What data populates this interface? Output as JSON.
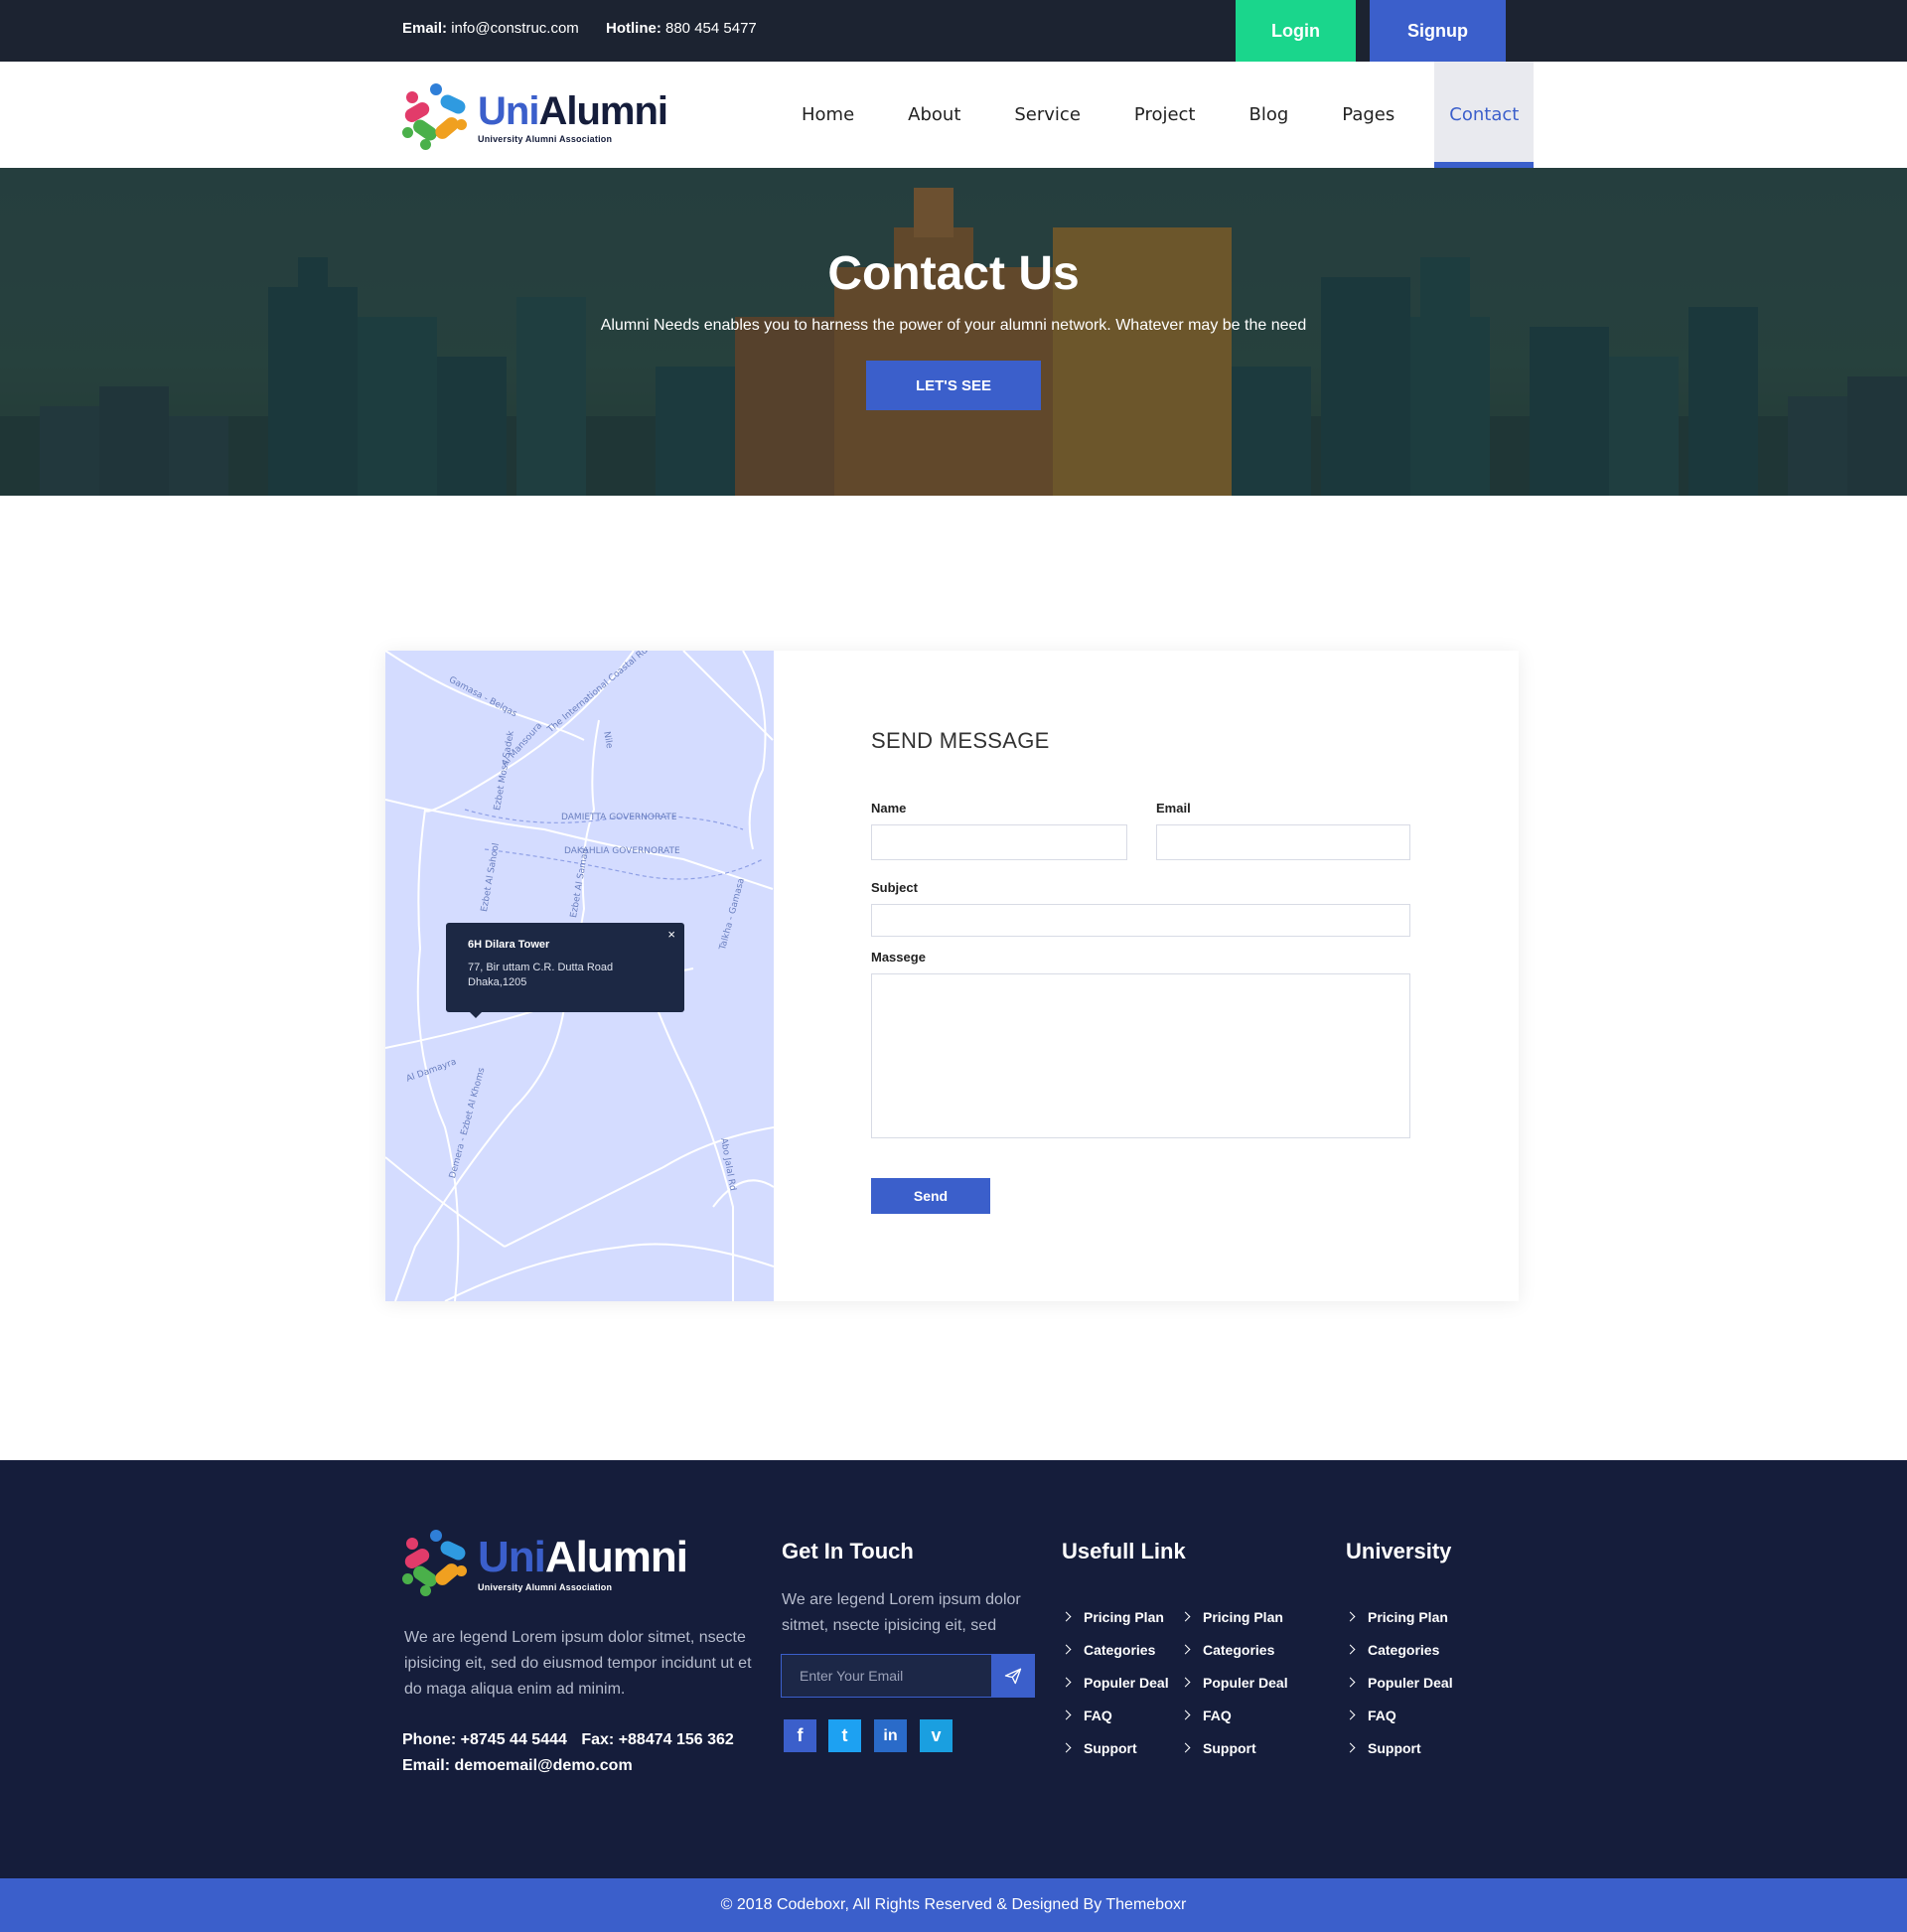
{
  "topbar": {
    "email_label": "Email:",
    "email_value": "info@construc.com",
    "hotline_label": "Hotline:",
    "hotline_value": "880 454 5477",
    "login_label": "Login",
    "signup_label": "Signup"
  },
  "logo": {
    "brand_uni": "Uni",
    "brand_alumni": "Alumni",
    "tagline": "University Alumni Association"
  },
  "nav": {
    "items": [
      {
        "label": "Home"
      },
      {
        "label": "About"
      },
      {
        "label": "Service"
      },
      {
        "label": "Project"
      },
      {
        "label": "Blog"
      },
      {
        "label": "Pages"
      },
      {
        "label": "Contact",
        "active": true
      }
    ]
  },
  "hero": {
    "title": "Contact Us",
    "subtitle": "Alumni Needs enables you to harness the power of your alumni network. Whatever may be the need",
    "cta_label": "LET'S SEE"
  },
  "map": {
    "labels": [
      "Gamasa - Belqas",
      "The International Coastal Rd",
      "Al Mansoura",
      "Nile",
      "DAMIETTA GOVERNORATE",
      "DAKAHLIA GOVERNORATE",
      "Ezbet Moss Sadek",
      "Ezbet Al Sahool",
      "Ezbet Al Samad",
      "Talkha - Gamasa",
      "Al Damayra",
      "Demera - Ezbet Al Khoms",
      "Abo Jalal Rd"
    ],
    "popup": {
      "title": "6H Dilara Tower",
      "address_line1": "77, Bir uttam C.R. Dutta Road",
      "address_line2": "Dhaka,1205",
      "close": "×"
    }
  },
  "form": {
    "heading": "SEND MESSAGE",
    "name_label": "Name",
    "email_label": "Email",
    "subject_label": "Subject",
    "message_label": "Massege",
    "send_label": "Send"
  },
  "footer": {
    "description": "We are legend Lorem ipsum dolor sitmet, nsecte ipisicing eit, sed do eiusmod tempor incidunt ut et do maga aliqua enim ad minim.",
    "phone": "Phone: +8745 44 5444",
    "fax": "Fax: +88474 156 362",
    "email": "Email: demoemail@demo.com",
    "get_in_touch": {
      "title": "Get In Touch",
      "text": "We are legend Lorem ipsum dolor sitmet, nsecte ipisicing eit, sed",
      "placeholder": "Enter Your Email"
    },
    "social": [
      "facebook-icon",
      "twitter-icon",
      "linkedin-icon",
      "vimeo-icon"
    ],
    "useful_link": {
      "title": "Usefull Link",
      "col1": [
        "Pricing Plan",
        "Categories",
        "Populer Deal",
        "FAQ",
        "Support"
      ],
      "col2": [
        "Pricing Plan",
        "Categories",
        "Populer Deal",
        "FAQ",
        "Support"
      ]
    },
    "university": {
      "title": "University",
      "items": [
        "Pricing Plan",
        "Categories",
        "Populer Deal",
        "FAQ",
        "Support"
      ]
    }
  },
  "copyright": "© 2018 Codeboxr, All Rights Reserved & Designed By Themeboxr",
  "colors": {
    "primary": "#3b5fcb",
    "login_green": "#1ad68c",
    "topbar": "#1c2331",
    "footer": "#151d3b",
    "map_bg": "#d4dcff"
  }
}
